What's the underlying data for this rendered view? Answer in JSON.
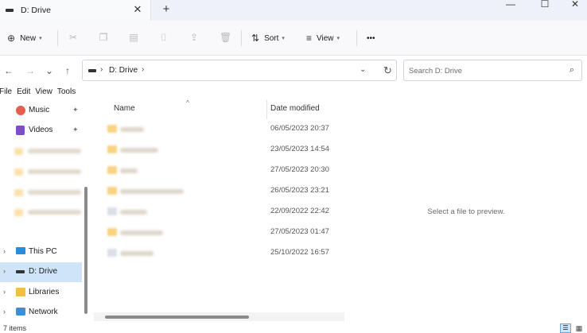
{
  "tab": {
    "title": "D: Drive",
    "close": "✕",
    "add": "+"
  },
  "window": {
    "minimize": "—",
    "maximize": "☐",
    "close": "✕"
  },
  "commands": {
    "new": "New",
    "sort": "Sort",
    "view": "View",
    "more": "•••"
  },
  "icons": {
    "new": "⊕",
    "sort": "⇅",
    "view": "≡",
    "back": "←",
    "forward": "→",
    "recent": "⌄",
    "up": "↑",
    "refresh": "↻",
    "search": "⌕",
    "chevron": "›",
    "dropdown": "⌄",
    "pin": "📌",
    "sort_arrow": "^"
  },
  "address": {
    "path": "D: Drive"
  },
  "search": {
    "placeholder": "Search D: Drive"
  },
  "menu": [
    "File",
    "Edit",
    "View",
    "Tools"
  ],
  "sidebar": {
    "quick": [
      {
        "label": "Music"
      },
      {
        "label": "Videos"
      }
    ],
    "tree": [
      {
        "label": "This PC"
      },
      {
        "label": "D: Drive"
      },
      {
        "label": "Libraries"
      },
      {
        "label": "Network"
      }
    ]
  },
  "columns": {
    "name": "Name",
    "date": "Date modified"
  },
  "files": [
    {
      "date": "06/05/2023 20:37"
    },
    {
      "date": "23/05/2023 14:54"
    },
    {
      "date": "27/05/2023 20:30"
    },
    {
      "date": "26/05/2023 23:21"
    },
    {
      "date": "22/09/2022 22:42"
    },
    {
      "date": "27/05/2023 01:47"
    },
    {
      "date": "25/10/2022 16:57"
    }
  ],
  "preview": {
    "message": "Select a file to preview."
  },
  "status": {
    "items": "7 items"
  }
}
